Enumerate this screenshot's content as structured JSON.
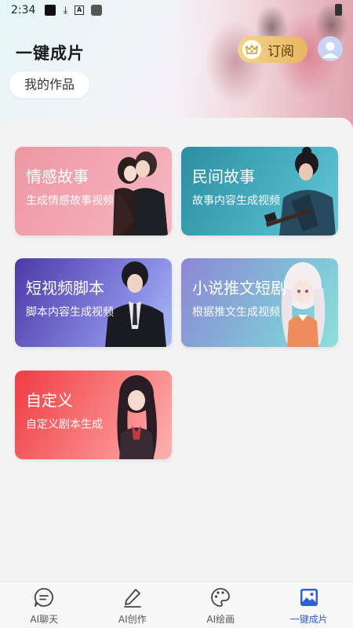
{
  "status_bar": {
    "time": "2:34"
  },
  "header": {
    "title": "一键成片",
    "my_works_label": "我的作品",
    "subscribe_label": "订阅"
  },
  "cards": [
    {
      "title": "情感故事",
      "subtitle": "生成情感故事视频",
      "color": "#ee97a4"
    },
    {
      "title": "民间故事",
      "subtitle": "故事内容生成视频",
      "color": "#2b8ea3"
    },
    {
      "title": "短视频脚本",
      "subtitle": "脚本内容生成视频",
      "color": "#4d39a8"
    },
    {
      "title": "小说推文短剧",
      "subtitle": "根据推文生成视频",
      "color": "#8e86d6"
    },
    {
      "title": "自定义",
      "subtitle": "自定义剧本生成",
      "color": "#ef3c43"
    }
  ],
  "bottom_nav": {
    "active_color": "#2e5fd9",
    "items": [
      {
        "label": "AI聊天",
        "icon": "chat-bubble-icon"
      },
      {
        "label": "AI创作",
        "icon": "pencil-icon"
      },
      {
        "label": "AI绘画",
        "icon": "palette-icon"
      },
      {
        "label": "一键成片",
        "icon": "image-icon",
        "active": true
      }
    ]
  }
}
